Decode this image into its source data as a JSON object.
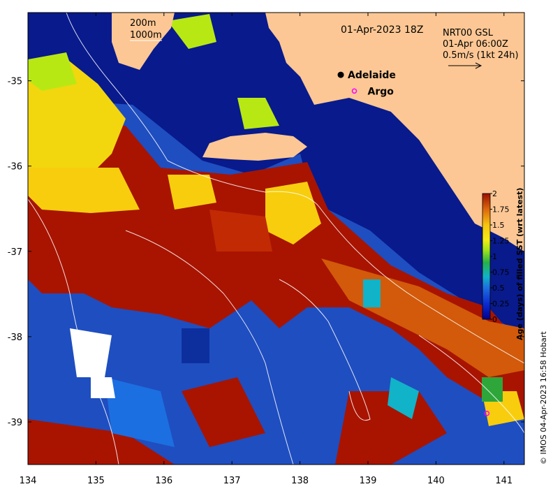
{
  "map": {
    "date_label": "01-Apr-2023 18Z",
    "legend_depth": [
      "200m",
      "1000m"
    ],
    "current_info": [
      "NRT00 GSL",
      "01-Apr 06:00Z",
      "0.5m/s (1kt 24h)"
    ],
    "places": [
      {
        "name": "Adelaide",
        "lon": 138.6,
        "lat": -34.93,
        "marker": "filled-dot"
      },
      {
        "name": "Argo",
        "lon": 138.8,
        "lat": -35.12,
        "marker": "magenta-ring"
      }
    ],
    "argo_extra": {
      "lon": 140.75,
      "lat": -38.9
    },
    "x_ticks": [
      "134",
      "135",
      "136",
      "137",
      "138",
      "139",
      "140",
      "141"
    ],
    "y_ticks": [
      "-35",
      "-36",
      "-37",
      "-38",
      "-39"
    ],
    "lon_range": [
      134,
      141.3
    ],
    "lat_range": [
      -39.5,
      -34.2
    ],
    "colorbar": {
      "title": "Age (days) of filled SST (wrt latest)",
      "ticks": [
        "2",
        "1.75",
        "1.5",
        "1.25",
        "1",
        "0.75",
        "0.5",
        "0.25",
        "0"
      ],
      "range": [
        0,
        2
      ]
    },
    "credit": "© IMOS 04-Apr-2023 16:58 Hobart",
    "colors": {
      "land": "#fcc794",
      "ocean_dark": "#081a8c",
      "ocean_mid": "#1f4ec0",
      "red": "#a81400",
      "orange": "#d25a0a",
      "yellow": "#f7cd0e",
      "lime": "#b8e814",
      "green": "#2ea63a",
      "cyan": "#10b3c8",
      "missing": "#ffffff"
    }
  }
}
